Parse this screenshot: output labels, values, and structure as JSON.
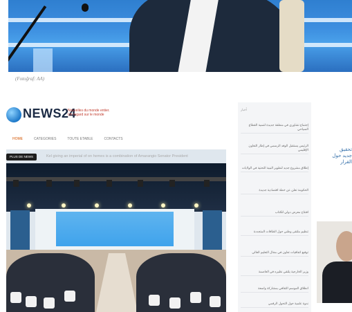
{
  "caption": "(Fotoğraf: AA)",
  "site": {
    "logo": "NEWS24",
    "tagline": "Nouvelles du monde entier. Un regard sur le monde",
    "nav": [
      "HOME",
      "CATEGORIES",
      "TOUTE ETABLE",
      "CONTACTS"
    ],
    "headline_badge": "PLUS DE NEWS",
    "headline": "Kel giving an imperial of on hemes is a combination of Amarangio Senator President"
  },
  "sidebar": {
    "heading": "أخبار",
    "items": [
      "إجتماع تشاوري في منطقة جديدة لتنمية القطاع السياحي",
      "الرئيس يستقبل الوفد الرسمي في إطار التعاون الإقليمي",
      "إطلاق مشروع جديد لتطوير البنية التحتية في الولايات",
      "الحكومة تعلن عن خطة اقتصادية جديدة",
      "افتتاح معرض دولي للكتاب",
      "تنظيم ملتقى وطني حول الطاقات المتجددة",
      "توقيع اتفاقيات تعاون في مجال التعليم العالي",
      "وزير الخارجية يلتقي نظيره في العاصمة",
      "انطلاق الموسم الثقافي بمشاركة واسعة",
      "ندوة علمية حول التحول الرقمي"
    ]
  },
  "right_text": "تحقيق جديد حول القرار",
  "colors": {
    "brand": "#1b2a44",
    "accent": "#d35400",
    "sidebar_bg": "#f4f5f7",
    "right_text": "#2f6ca8"
  }
}
